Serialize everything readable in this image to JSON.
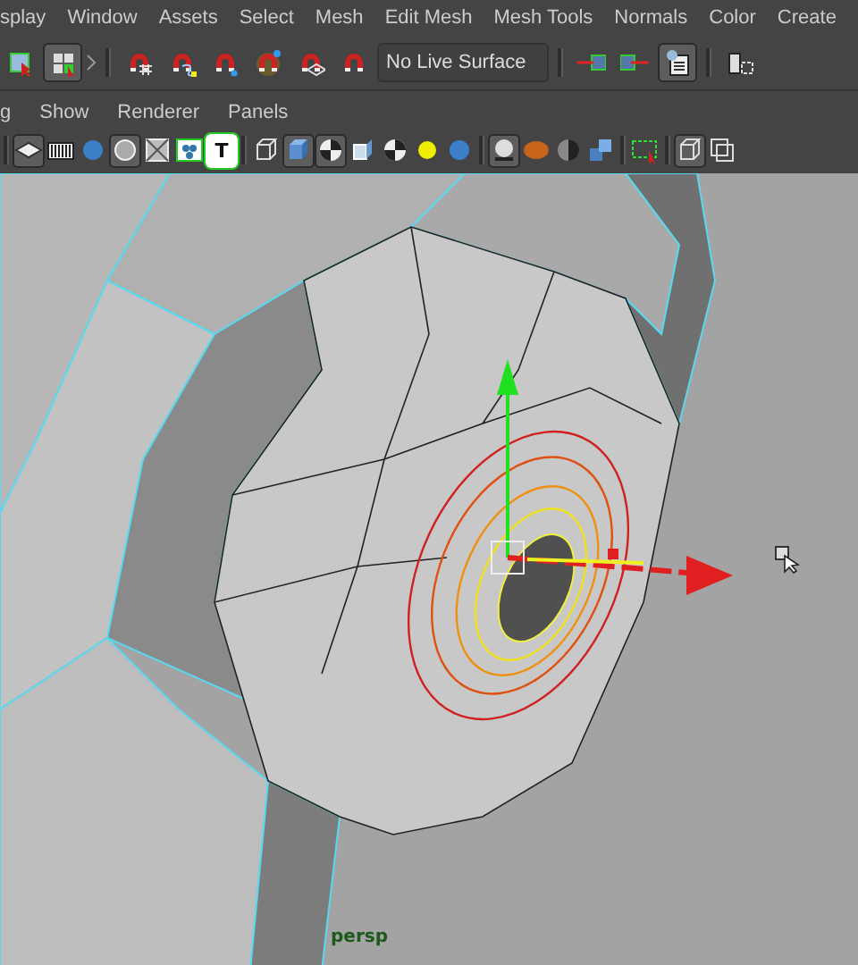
{
  "menu_bar": [
    "splay",
    "Window",
    "Assets",
    "Select",
    "Mesh",
    "Edit Mesh",
    "Mesh Tools",
    "Normals",
    "Color",
    "Create"
  ],
  "status_line": {
    "tools_left": [
      {
        "kind": "select",
        "pressed": false
      },
      {
        "kind": "grid",
        "pressed": true
      }
    ],
    "snap_tools": [
      {
        "kind": "magnet-grid",
        "pressed": false
      },
      {
        "kind": "magnet-curve",
        "pressed": false
      },
      {
        "kind": "magnet-point",
        "pressed": false
      },
      {
        "kind": "magnet-view",
        "pressed": false
      },
      {
        "kind": "magnet-plane",
        "pressed": false
      },
      {
        "kind": "magnet",
        "pressed": false
      }
    ],
    "live_surface": "No Live Surface",
    "tools_right": [
      {
        "kind": "arrow-in",
        "pressed": false
      },
      {
        "kind": "arrow-out",
        "pressed": false
      },
      {
        "kind": "sheet",
        "pressed": true
      },
      {
        "kind": "frame",
        "pressed": false
      }
    ]
  },
  "panel_menu": [
    "g",
    "Show",
    "Renderer",
    "Panels"
  ],
  "panel_toolbar": [
    {
      "kind": "plane",
      "pressed": true
    },
    {
      "kind": "film",
      "pressed": false
    },
    {
      "kind": "ball",
      "pressed": false
    },
    {
      "kind": "ring",
      "pressed": true
    },
    {
      "kind": "mesh",
      "pressed": false
    },
    {
      "kind": "dots",
      "pressed": false
    },
    {
      "kind": "text",
      "label": "T",
      "pressed": false
    },
    {
      "kind": "sep"
    },
    {
      "kind": "wire-cube",
      "pressed": false
    },
    {
      "kind": "solid-cube",
      "pressed": true
    },
    {
      "kind": "checker",
      "pressed": true
    },
    {
      "kind": "light-cube",
      "pressed": false
    },
    {
      "kind": "checker",
      "pressed": false
    },
    {
      "kind": "glow",
      "pressed": false
    },
    {
      "kind": "ball",
      "pressed": false
    },
    {
      "kind": "sep"
    },
    {
      "kind": "shade-ball",
      "pressed": true
    },
    {
      "kind": "orange-ball",
      "pressed": false
    },
    {
      "kind": "half-ball",
      "pressed": false
    },
    {
      "kind": "cubes",
      "pressed": false
    },
    {
      "kind": "sep"
    },
    {
      "kind": "marquee",
      "pressed": false
    },
    {
      "kind": "sep"
    },
    {
      "kind": "wire-cube",
      "pressed": true
    },
    {
      "kind": "squares",
      "pressed": false
    }
  ],
  "viewport": {
    "camera": "persp"
  }
}
